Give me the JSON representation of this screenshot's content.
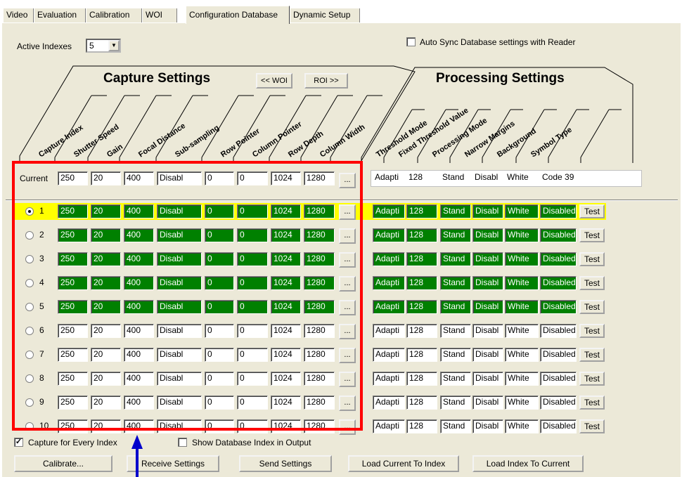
{
  "tabs": [
    "Video",
    "Evaluation",
    "Calibration",
    "WOI",
    "Configuration Database",
    "Dynamic Setup"
  ],
  "active_tab": "Configuration Database",
  "active_indexes": {
    "label": "Active Indexes",
    "value": "5"
  },
  "auto_sync": {
    "label": "Auto Sync Database settings with Reader",
    "checked": false
  },
  "capture_section": {
    "title": "Capture Settings",
    "woi_button": "<< WOI",
    "roi_button": "ROI >>",
    "columns": [
      "Capture Index",
      "Shutter Speed",
      "Gain",
      "Focal Distance",
      "Sub-sampling",
      "Row Pointer",
      "Column Pointer",
      "Row Depth",
      "Column Width"
    ]
  },
  "processing_section": {
    "title": "Processing Settings",
    "columns": [
      "Threshold Mode",
      "Fixed Threshold Value",
      "Processing Mode",
      "Narrow Margins",
      "Background",
      "Symbol Type"
    ]
  },
  "current": {
    "label": "Current",
    "capture": [
      "250",
      "20",
      "400",
      "Disabl",
      "0",
      "0",
      "1024",
      "1280"
    ],
    "processing": [
      "Adapti",
      "128",
      "Stand",
      "Disabl",
      "White",
      "Code 39"
    ],
    "browse": "..."
  },
  "rows": [
    {
      "index": "1",
      "selected": true,
      "active": true
    },
    {
      "index": "2",
      "selected": false,
      "active": true
    },
    {
      "index": "3",
      "selected": false,
      "active": true
    },
    {
      "index": "4",
      "selected": false,
      "active": true
    },
    {
      "index": "5",
      "selected": false,
      "active": true
    },
    {
      "index": "6",
      "selected": false,
      "active": false
    },
    {
      "index": "7",
      "selected": false,
      "active": false
    },
    {
      "index": "8",
      "selected": false,
      "active": false
    },
    {
      "index": "9",
      "selected": false,
      "active": false
    },
    {
      "index": "10",
      "selected": false,
      "active": false
    }
  ],
  "row_capture": [
    "250",
    "20",
    "400",
    "Disabl",
    "0",
    "0",
    "1024",
    "1280"
  ],
  "row_processing": [
    "Adapti",
    "128",
    "Stand",
    "Disabl",
    "White",
    "Disabled"
  ],
  "row_browse": "...",
  "row_test": "Test",
  "capture_every_index": {
    "label": "Capture for Every Index",
    "checked": true
  },
  "show_db_index": {
    "label": "Show Database Index in Output",
    "checked": false
  },
  "buttons": {
    "calibrate": "Calibrate...",
    "receive": "Receive Settings",
    "send": "Send Settings",
    "load_current": "Load Current To Index",
    "load_index": "Load Index To Current"
  },
  "colors": {
    "active_cell": "#008000",
    "selected_row": "#ffff00",
    "highlight_box": "#ff0000",
    "arrow": "#0000cc",
    "panel": "#ece9d8"
  }
}
